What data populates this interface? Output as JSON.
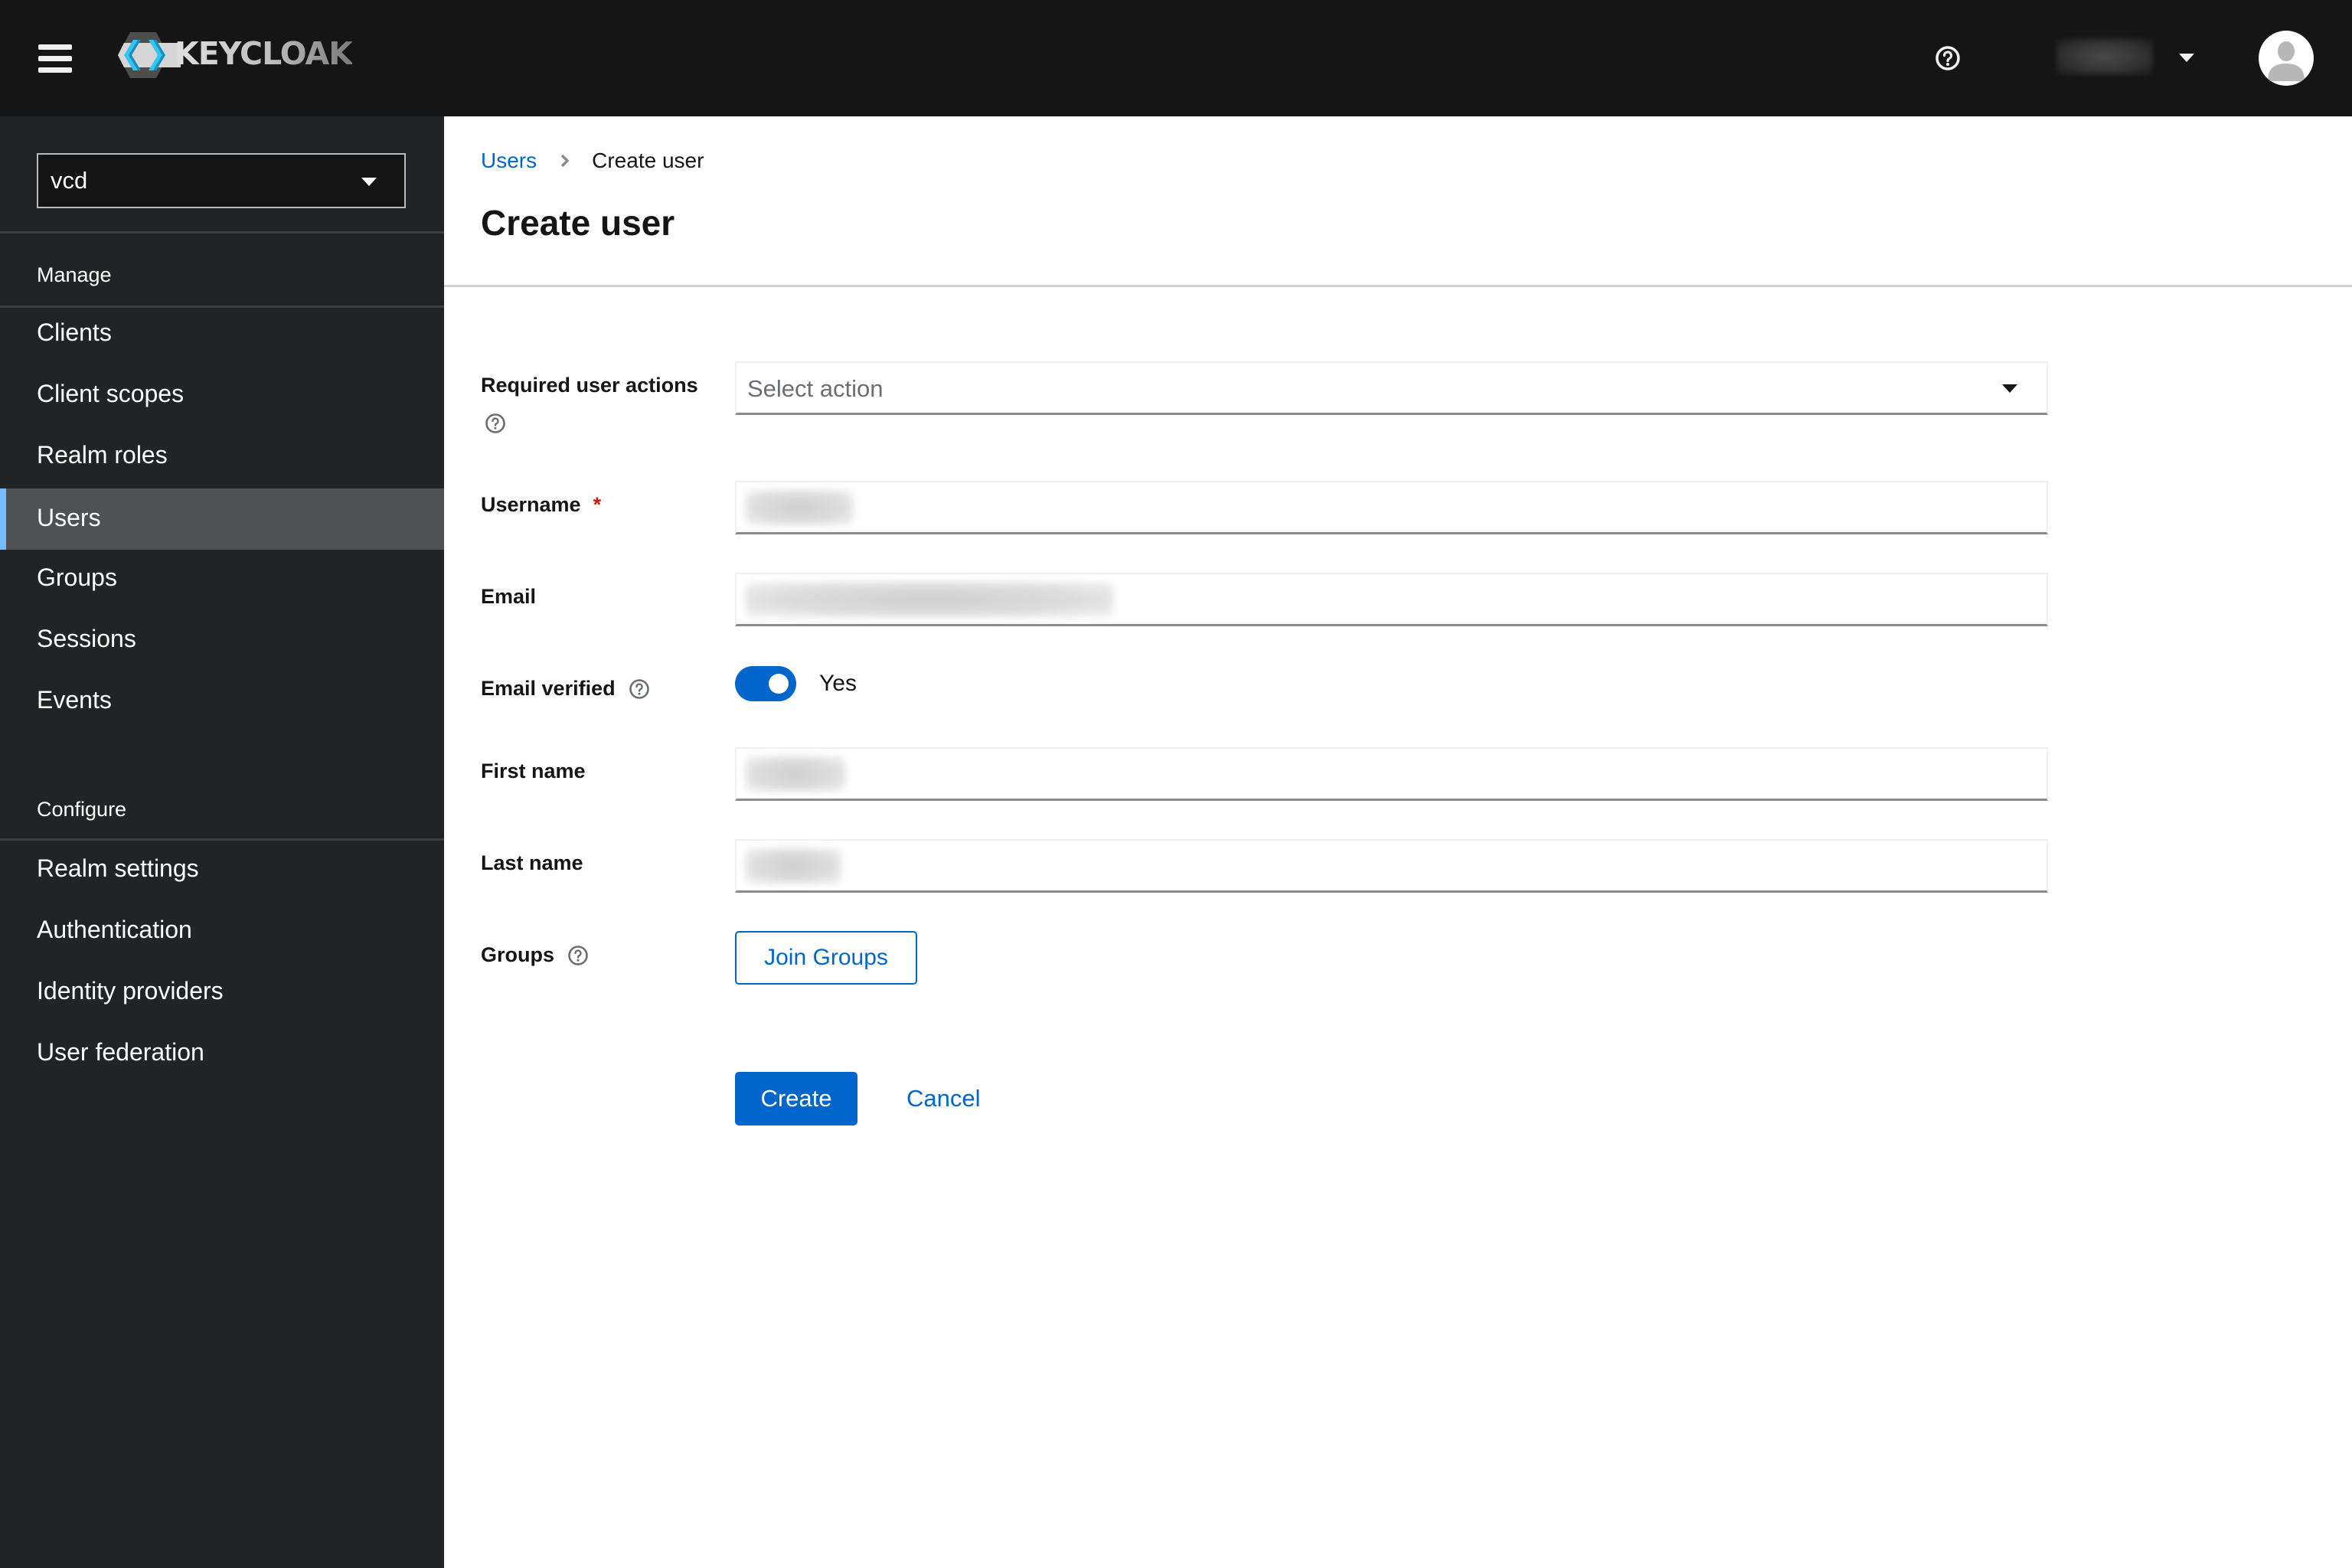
{
  "masthead": {
    "brand": "KEYCLOAK",
    "menu_icon": "hamburger-menu-icon",
    "help_icon": "question-circle-icon",
    "user_name": "",
    "user_dropdown_icon": "caret-down-icon",
    "avatar_icon": "user-avatar-icon"
  },
  "sidebar": {
    "realm_selector": {
      "value": "vcd",
      "icon": "caret-down-icon"
    },
    "sections": [
      {
        "title": "Manage",
        "items": [
          {
            "label": "Clients",
            "active": false
          },
          {
            "label": "Client scopes",
            "active": false
          },
          {
            "label": "Realm roles",
            "active": false
          },
          {
            "label": "Users",
            "active": true
          },
          {
            "label": "Groups",
            "active": false
          },
          {
            "label": "Sessions",
            "active": false
          },
          {
            "label": "Events",
            "active": false
          }
        ]
      },
      {
        "title": "Configure",
        "items": [
          {
            "label": "Realm settings",
            "active": false
          },
          {
            "label": "Authentication",
            "active": false
          },
          {
            "label": "Identity providers",
            "active": false
          },
          {
            "label": "User federation",
            "active": false
          }
        ]
      }
    ]
  },
  "breadcrumb": {
    "items": [
      {
        "label": "Users",
        "link": true
      },
      {
        "label": "Create user",
        "link": false
      }
    ],
    "separator_icon": "angle-right-icon"
  },
  "page": {
    "title": "Create user"
  },
  "form": {
    "required_actions": {
      "label": "Required user actions",
      "placeholder": "Select action",
      "help_icon": "question-circle-icon"
    },
    "username": {
      "label": "Username",
      "required_marker": "*",
      "value": ""
    },
    "email": {
      "label": "Email",
      "value": ""
    },
    "email_verified": {
      "label": "Email verified",
      "help_icon": "question-circle-icon",
      "checked": true,
      "state_label": "Yes"
    },
    "first_name": {
      "label": "First name",
      "value": ""
    },
    "last_name": {
      "label": "Last name",
      "value": ""
    },
    "groups": {
      "label": "Groups",
      "help_icon": "question-circle-icon",
      "button_label": "Join Groups"
    },
    "actions": {
      "create_label": "Create",
      "cancel_label": "Cancel"
    }
  },
  "colors": {
    "masthead_bg": "#151515",
    "sidebar_bg": "#212427",
    "sidebar_active_bg": "#4f5255",
    "sidebar_active_accent": "#73bcf7",
    "primary": "#0066cc",
    "required": "#c9190b",
    "text": "#151515",
    "placeholder": "#6a6e73"
  }
}
